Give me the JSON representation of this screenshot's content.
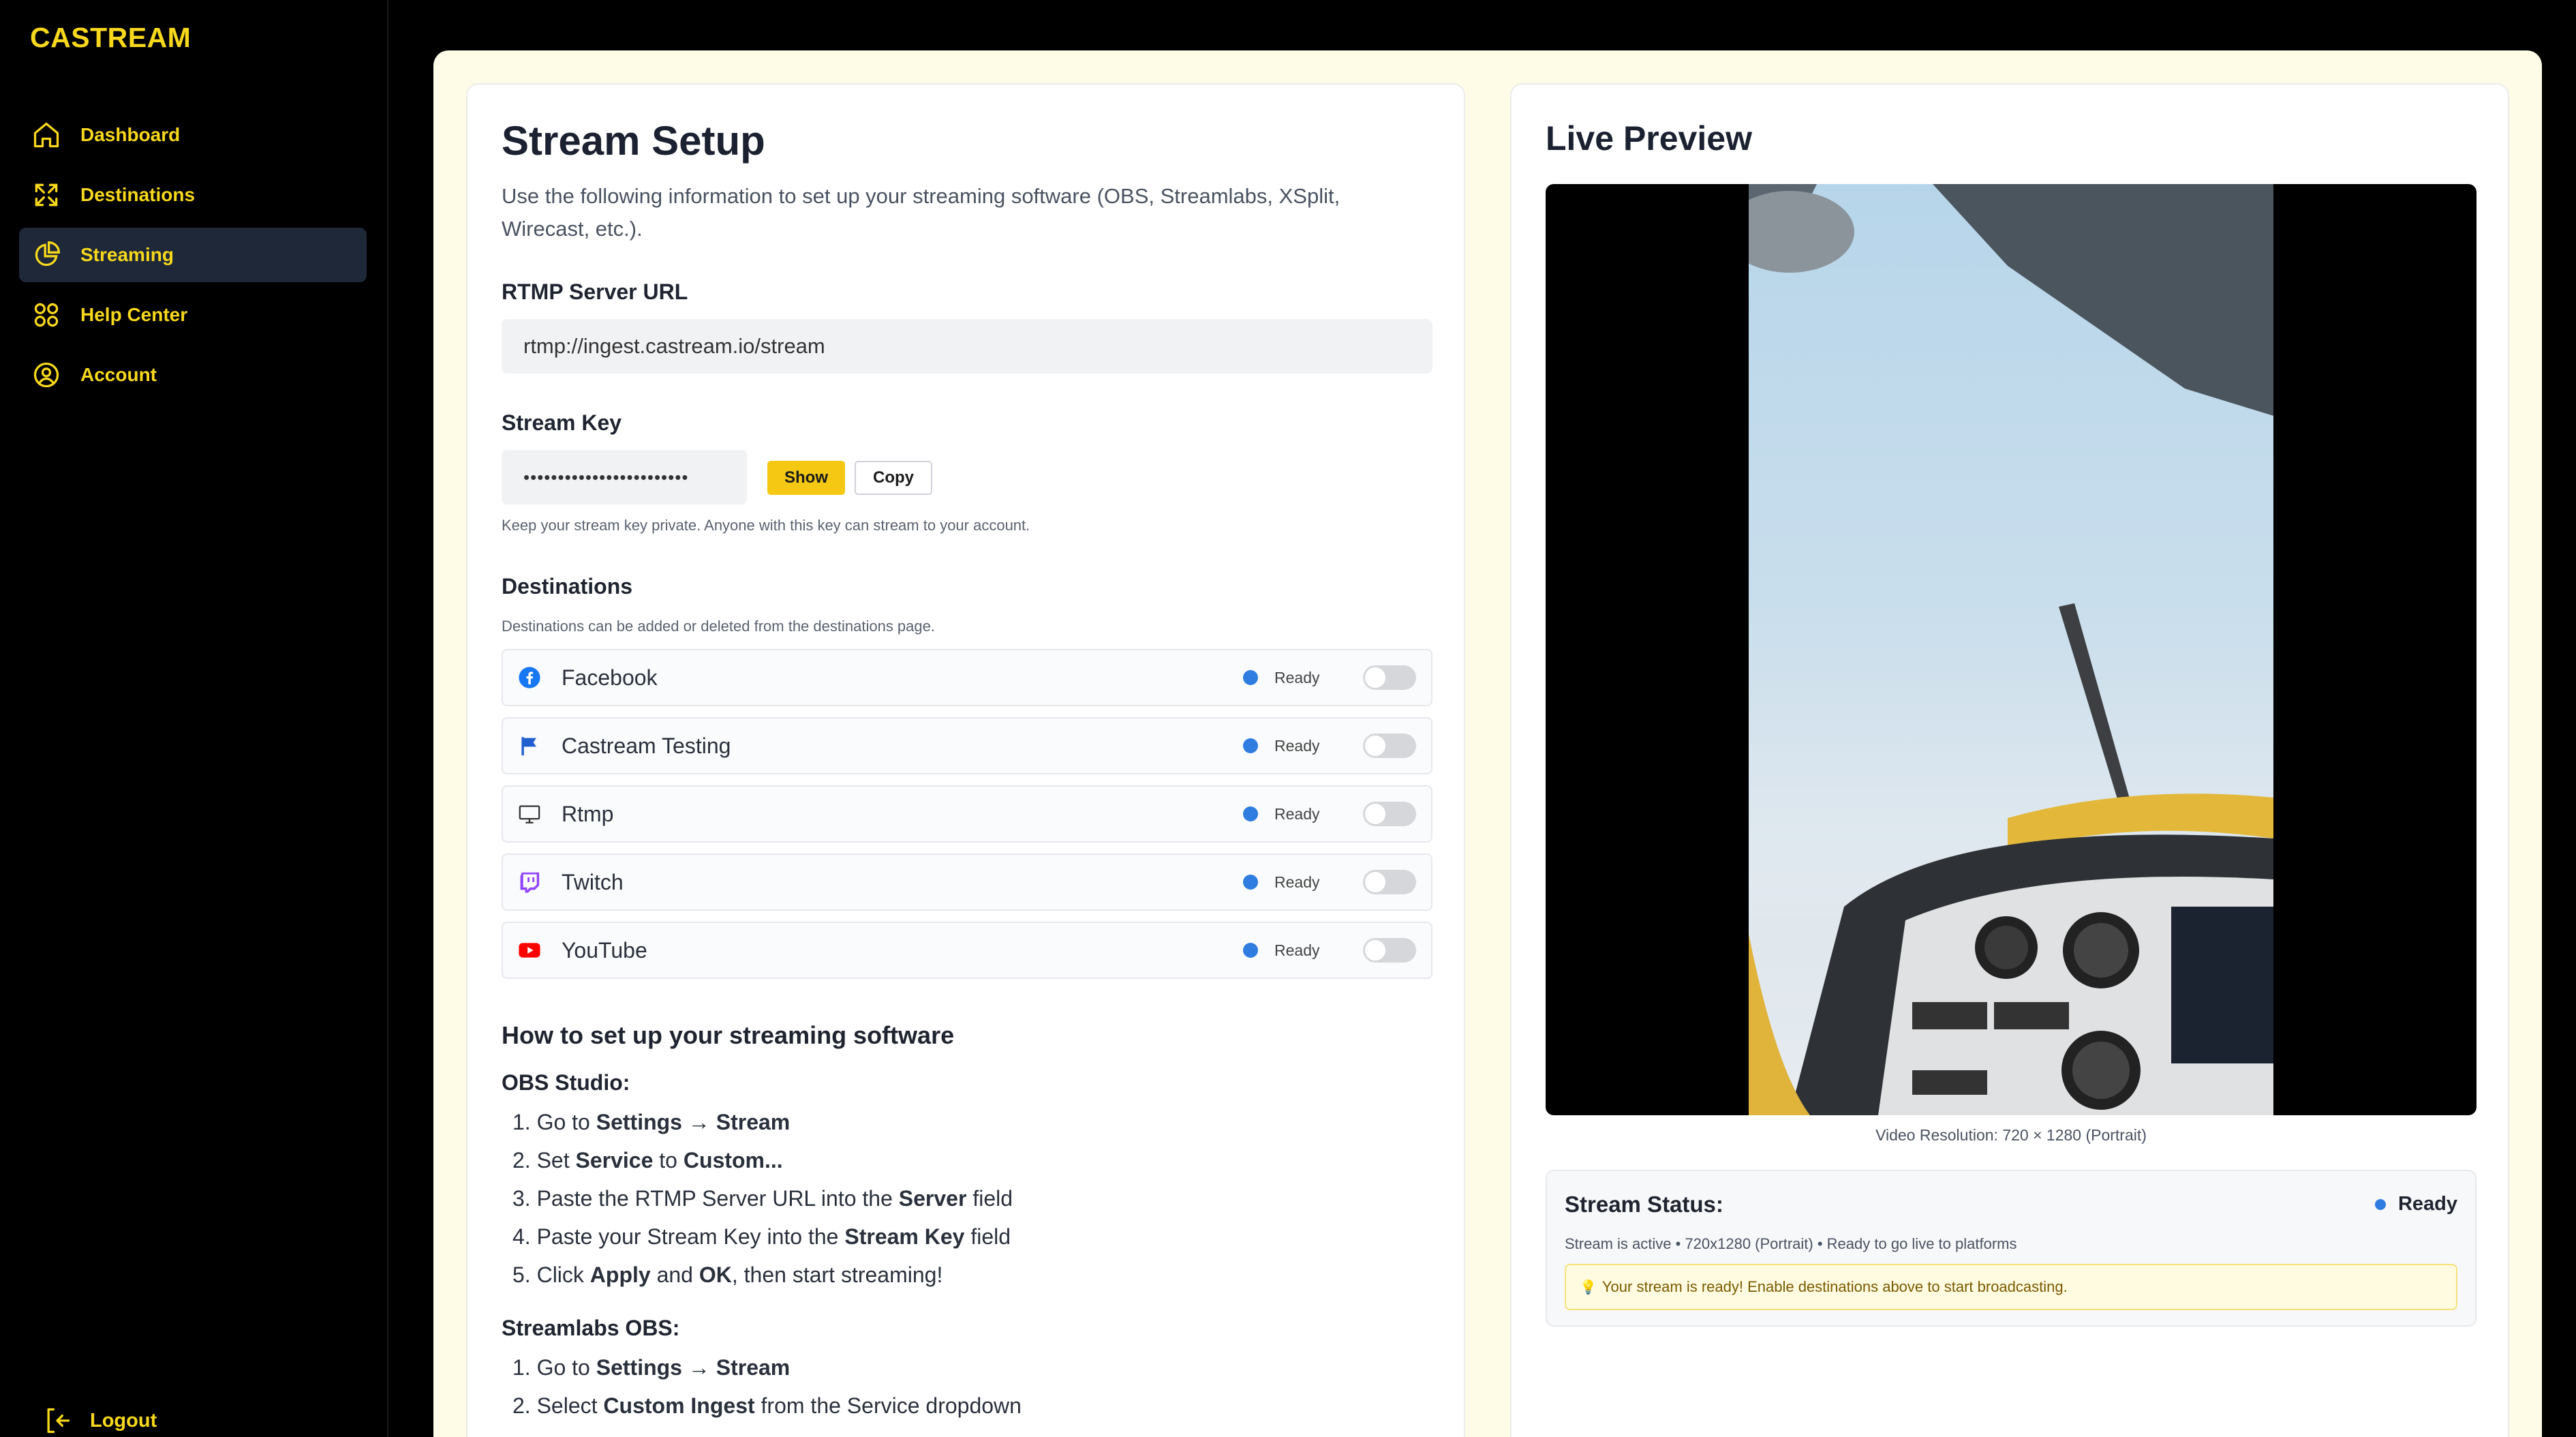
{
  "brand": "CASTREAM",
  "sidebar": {
    "items": [
      {
        "label": "Dashboard",
        "icon": "home-icon"
      },
      {
        "label": "Destinations",
        "icon": "expand-icon"
      },
      {
        "label": "Streaming",
        "icon": "pie-chart-icon",
        "active": true
      },
      {
        "label": "Help Center",
        "icon": "grid-icon"
      },
      {
        "label": "Account",
        "icon": "user-circle-icon"
      }
    ],
    "logout": "Logout"
  },
  "setup": {
    "title": "Stream Setup",
    "intro": "Use the following information to set up your streaming software (OBS, Streamlabs, XSplit, Wirecast, etc.).",
    "rtmp_label": "RTMP Server URL",
    "rtmp_value": "rtmp://ingest.castream.io/stream",
    "key_label": "Stream Key",
    "key_value": "••••••••••••••••••••••••",
    "show_label": "Show",
    "copy_label": "Copy",
    "key_hint": "Keep your stream key private. Anyone with this key can stream to your account.",
    "destinations_label": "Destinations",
    "destinations_hint": "Destinations can be added or deleted from the destinations page."
  },
  "destinations": [
    {
      "name": "Facebook",
      "status": "Ready",
      "icon": "facebook-icon",
      "enabled": false
    },
    {
      "name": "Castream Testing",
      "status": "Ready",
      "icon": "flag-icon",
      "enabled": false
    },
    {
      "name": "Rtmp",
      "status": "Ready",
      "icon": "monitor-icon",
      "enabled": false
    },
    {
      "name": "Twitch",
      "status": "Ready",
      "icon": "twitch-icon",
      "enabled": false
    },
    {
      "name": "YouTube",
      "status": "Ready",
      "icon": "youtube-icon",
      "enabled": false
    }
  ],
  "howto": {
    "title": "How to set up your streaming software",
    "obs_title": "OBS Studio:",
    "obs_steps": [
      [
        "1. Go to ",
        "Settings → Stream",
        "",
        "",
        ""
      ],
      [
        "2. Set ",
        "Service",
        " to ",
        "Custom...",
        ""
      ],
      [
        "3. Paste the RTMP Server URL into the ",
        "Server",
        " field",
        "",
        ""
      ],
      [
        "4. Paste your Stream Key into the ",
        "Stream Key",
        " field",
        "",
        ""
      ],
      [
        "5. Click ",
        "Apply",
        " and ",
        "OK",
        ", then start streaming!"
      ]
    ],
    "slobs_title": "Streamlabs OBS:",
    "slobs_steps": [
      [
        "1. Go to ",
        "Settings → Stream",
        "",
        "",
        ""
      ],
      [
        "2. Select ",
        "Custom Ingest",
        " from the Service dropdown",
        "",
        ""
      ]
    ]
  },
  "preview": {
    "title": "Live Preview",
    "resolution": "Video Resolution: 720 × 1280 (Portrait)",
    "status_title": "Stream Status:",
    "status_state": "Ready",
    "status_desc": "Stream is active • 720x1280 (Portrait) • Ready to go live to platforms",
    "status_alert": "Your stream is ready! Enable destinations above to start broadcasting."
  },
  "colors": {
    "accent": "#f7d81c",
    "status_blue": "#2f7de1",
    "facebook": "#1877f2",
    "twitch": "#9146ff",
    "youtube": "#ff0000"
  }
}
